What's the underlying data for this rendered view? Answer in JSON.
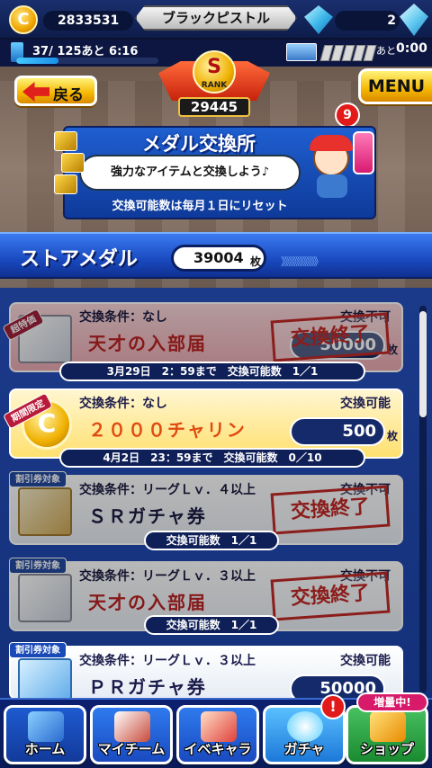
{
  "colors": {
    "accent_blue": "#1a4ac0",
    "button_yellow": "#f5b700",
    "stamp_red": "#e0201c"
  },
  "header": {
    "coin_icon_glyph": "C",
    "coins": "2833531",
    "player_name": "ブラックピストル",
    "diamonds": "2"
  },
  "subbar": {
    "stamina_text": "37/ 125あと  6:16",
    "stamina_fraction": 0.3,
    "timer_label": "あと",
    "timer": "0:00"
  },
  "nav": {
    "back_label": "戻る",
    "menu_label": "MENU",
    "notification_count": "9"
  },
  "rank": {
    "letter": "S",
    "word": "RANK",
    "score": "29445"
  },
  "banner": {
    "title": "メダル交換所",
    "speech": "強力なアイテムと交換しよう♪",
    "note": "交換可能数は毎月１日にリセット"
  },
  "store": {
    "title": "ストアメダル",
    "value": "39004",
    "unit": "枚",
    "chevrons": "》》》》》》》》》》"
  },
  "items": [
    {
      "tag": "超特価",
      "condition": "交換条件：なし",
      "status": "交換不可",
      "name": "天才の入部届",
      "price": "50000",
      "unit": "枚",
      "stamp": "交換終了",
      "info": "3月29日　2：59まで　交換可能数　1／1"
    },
    {
      "tag": "期間限定",
      "coin_glyph": "C",
      "condition": "交換条件：なし",
      "status": "交換可能",
      "name": "２０００チャリン",
      "price": "500",
      "unit": "枚",
      "info": "4月2日　23：59まで　交換可能数　0／10"
    },
    {
      "tag": "割引券対象",
      "condition": "交換条件：リーグＬｖ．４以上",
      "status": "交換不可",
      "name": "ＳＲガチャ券",
      "stamp": "交換終了",
      "info": "交換可能数　1／1"
    },
    {
      "tag": "割引券対象",
      "condition": "交換条件：リーグＬｖ．３以上",
      "status": "交換不可",
      "name": "天才の入部届",
      "stamp": "交換終了",
      "info": "交換可能数　1／1"
    },
    {
      "tag": "割引券対象",
      "condition": "交換条件：リーグＬｖ．３以上",
      "status": "交換可能",
      "name": "ＰＲガチャ券",
      "price": "50000"
    }
  ],
  "bottom_nav": [
    {
      "label": "ホーム",
      "icon": "home-icon"
    },
    {
      "label": "マイチーム",
      "icon": "team-icon"
    },
    {
      "label": "イベキャラ",
      "icon": "event-character-icon"
    },
    {
      "label": "ガチャ",
      "icon": "gacha-icon"
    },
    {
      "label": "ショップ",
      "icon": "shop-icon"
    }
  ],
  "gacha_alert": "!",
  "shop_badge": "増量中!"
}
